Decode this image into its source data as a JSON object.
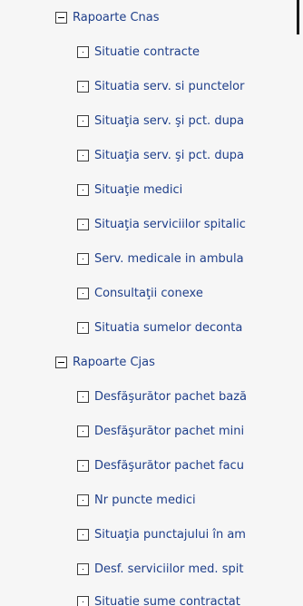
{
  "tree": {
    "group1": {
      "label": "Rapoarte Cnas",
      "items": [
        "Situatie contracte",
        "Situatia serv. si punctelor",
        "Situaţia serv. şi pct. dupa",
        "Situaţia serv. şi pct. dupa",
        "Situaţie medici",
        "Situaţia serviciilor spitalic",
        "Serv. medicale in ambula",
        "Consultaţii conexe",
        "Situatia sumelor deconta"
      ]
    },
    "group2": {
      "label": "Rapoarte Cjas",
      "items": [
        "Desfăşurător pachet bază",
        "Desfăşurător pachet mini",
        "Desfăşurător pachet facu",
        "Nr puncte medici",
        "Situaţia punctajului în am",
        "Desf. serviciilor med. spit",
        "Situatie sume contractat"
      ]
    }
  },
  "icons": {
    "expanded": "minus-box-icon",
    "leaf": "dot-box-icon"
  },
  "colors": {
    "background": "#f6f6f6",
    "link": "#1f3f8a",
    "border": "#3c3c3c"
  }
}
